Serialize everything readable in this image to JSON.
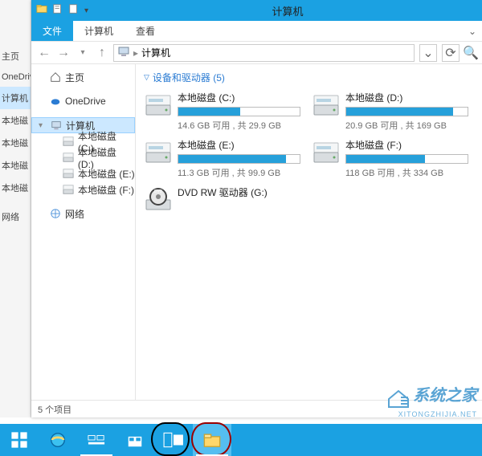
{
  "bgSidebar": [
    "主页",
    "OneDriv",
    "计算机",
    "本地磁",
    "本地磁",
    "本地磁",
    "本地磁",
    "网络"
  ],
  "titlebar": {
    "title": "计算机"
  },
  "ribbon": {
    "file": "文件",
    "tabs": [
      "计算机",
      "查看"
    ]
  },
  "address": {
    "path": "计算机"
  },
  "nav": {
    "home": "主页",
    "onedrive": "OneDrive",
    "computer": "计算机",
    "drives": [
      "本地磁盘 (C:)",
      "本地磁盘 (D:)",
      "本地磁盘 (E:)",
      "本地磁盘 (F:)"
    ],
    "network": "网络"
  },
  "section": {
    "header": "设备和驱动器 (5)"
  },
  "drives": [
    {
      "name": "本地磁盘 (C:)",
      "free": "14.6 GB 可用 , 共 29.9 GB",
      "pct": 51
    },
    {
      "name": "本地磁盘 (D:)",
      "free": "20.9 GB 可用 , 共 169 GB",
      "pct": 88
    },
    {
      "name": "本地磁盘 (E:)",
      "free": "11.3 GB 可用 , 共 99.9 GB",
      "pct": 89
    },
    {
      "name": "本地磁盘 (F:)",
      "free": "118 GB 可用 , 共 334 GB",
      "pct": 65
    }
  ],
  "dvd": {
    "name": "DVD RW 驱动器 (G:)"
  },
  "statusbar": {
    "count": "5 个项目"
  },
  "watermark": {
    "line1": "系统之家",
    "line2": "XITONGZHIJIA.NET"
  }
}
